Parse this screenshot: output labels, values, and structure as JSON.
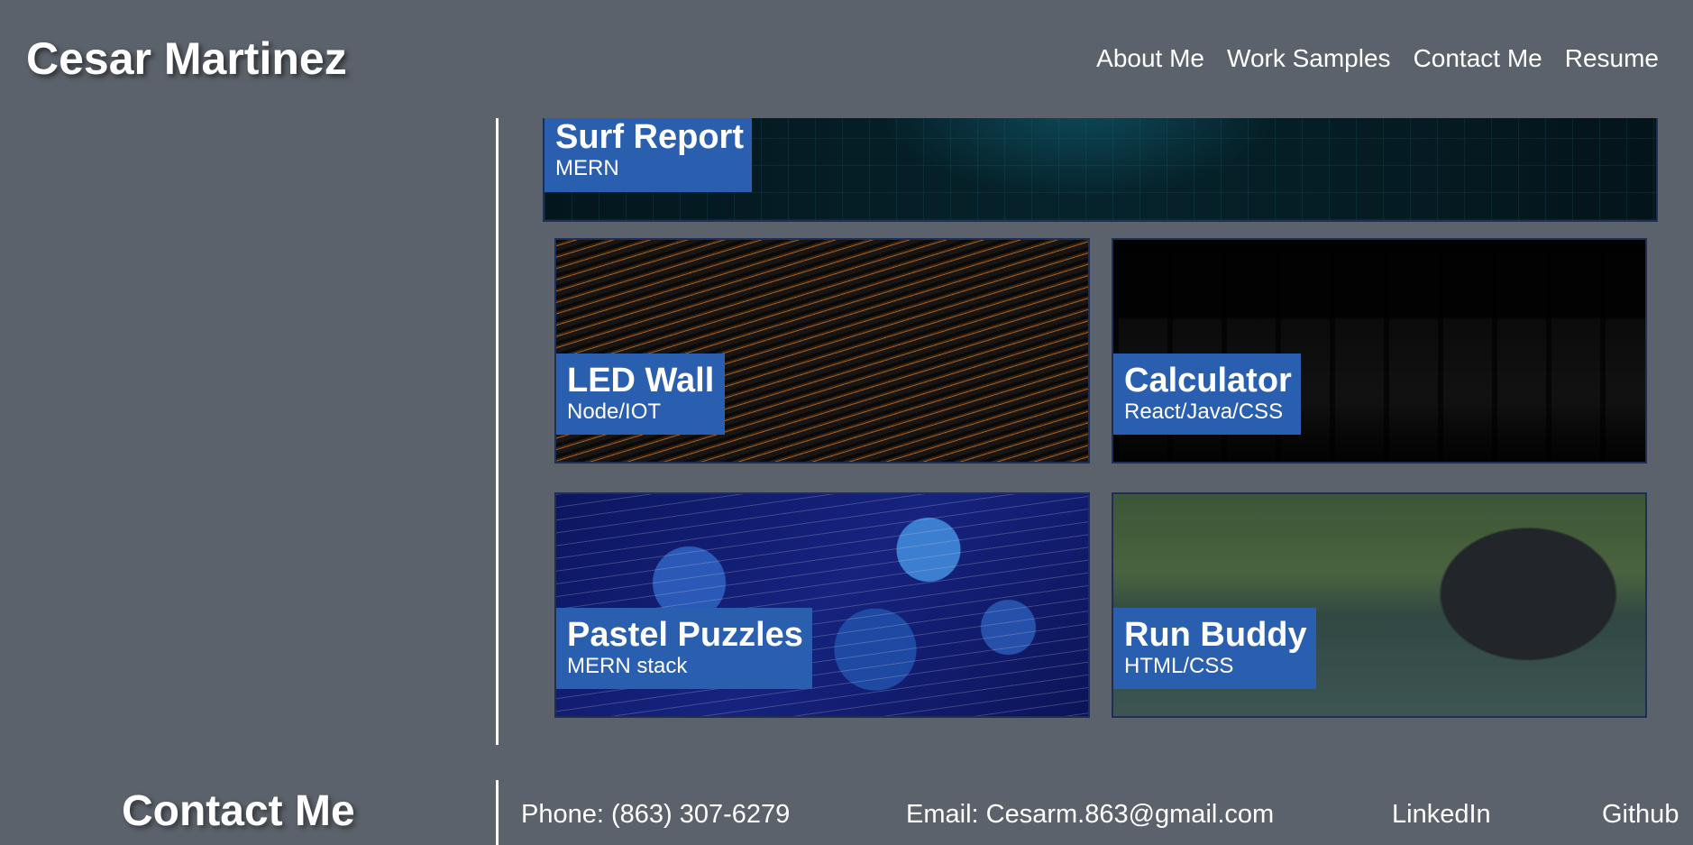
{
  "header": {
    "title": "Cesar Martinez",
    "nav": [
      "About Me",
      "Work Samples",
      "Contact Me",
      "Resume"
    ]
  },
  "projects": [
    {
      "title": "Surf Report",
      "tech": "MERN"
    },
    {
      "title": "LED Wall",
      "tech": "Node/IOT"
    },
    {
      "title": "Calculator",
      "tech": "React/Java/CSS"
    },
    {
      "title": "Pastel Puzzles",
      "tech": "MERN stack"
    },
    {
      "title": "Run Buddy",
      "tech": "HTML/CSS"
    }
  ],
  "footer": {
    "heading": "Contact Me",
    "phone": "Phone: (863) 307-6279",
    "email": "Email: Cesarm.863@gmail.com",
    "linkedin": "LinkedIn",
    "github": "Github"
  },
  "colors": {
    "background": "#5c626b",
    "label": "#2a5fb0",
    "card_border": "#1e2f55",
    "text": "#ffffff"
  }
}
